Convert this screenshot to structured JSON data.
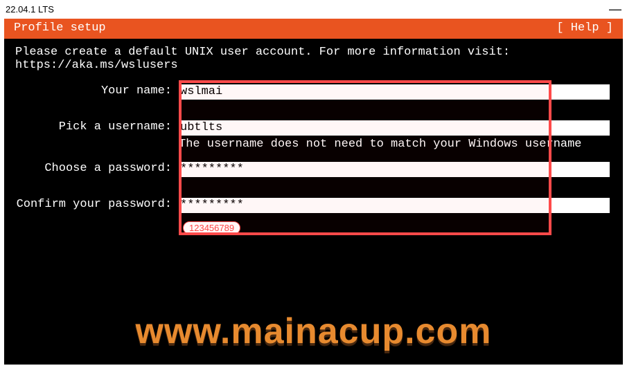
{
  "window": {
    "title": " 22.04.1 LTS",
    "minimize": "—"
  },
  "header": {
    "title": "Profile setup",
    "help": "[ Help ]"
  },
  "intro": {
    "line1": "Please create a default UNIX user account. For more information visit:",
    "line2": "https://aka.ms/wslusers"
  },
  "form": {
    "name_label": "Your name:",
    "name_value": "wslmai",
    "username_label": "Pick a username:",
    "username_value": "ubtlts",
    "username_hint": "The username does not need to match your Windows username",
    "password_label": "Choose a password:",
    "password_value": "*********",
    "confirm_label": "Confirm your password:",
    "confirm_value": "*********",
    "pw_annotation": "123456789"
  },
  "watermark": "www.mainacup.com"
}
